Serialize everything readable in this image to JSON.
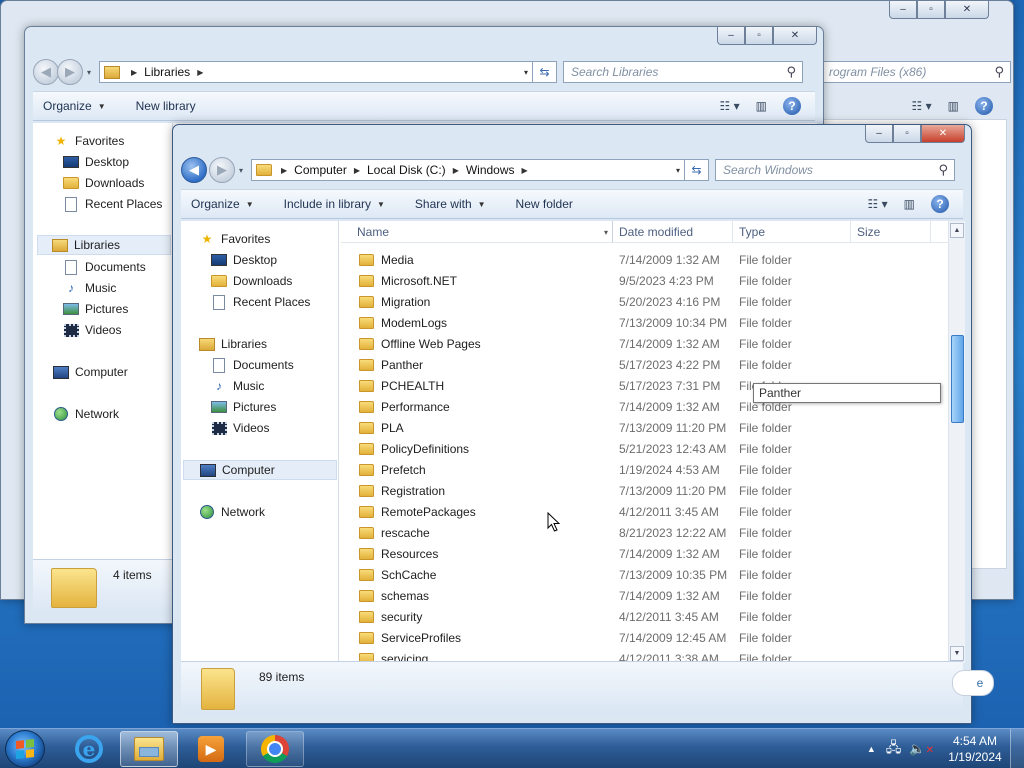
{
  "window_back": {
    "title_buttons": {
      "min": "–",
      "max": "▫",
      "close": "✕"
    },
    "search_placeholder": "rogram Files (x86)"
  },
  "window_mid": {
    "address": [
      "Libraries"
    ],
    "search_placeholder": "Search Libraries",
    "toolbar": {
      "organize": "Organize",
      "new_library": "New library"
    },
    "nav": {
      "favorites": "Favorites",
      "desktop": "Desktop",
      "downloads": "Downloads",
      "recent": "Recent Places",
      "libraries": "Libraries",
      "documents": "Documents",
      "music": "Music",
      "pictures": "Pictures",
      "videos": "Videos",
      "computer": "Computer",
      "network": "Network"
    },
    "status": "4 items"
  },
  "window_front": {
    "address": [
      "Computer",
      "Local Disk (C:)",
      "Windows"
    ],
    "search_placeholder": "Search Windows",
    "toolbar": {
      "organize": "Organize",
      "include": "Include in library",
      "share": "Share with",
      "new_folder": "New folder"
    },
    "nav": {
      "favorites": "Favorites",
      "desktop": "Desktop",
      "downloads": "Downloads",
      "recent": "Recent Places",
      "libraries": "Libraries",
      "documents": "Documents",
      "music": "Music",
      "pictures": "Pictures",
      "videos": "Videos",
      "computer": "Computer",
      "network": "Network"
    },
    "columns": {
      "name": "Name",
      "date": "Date modified",
      "type": "Type",
      "size": "Size"
    },
    "rows": [
      {
        "name": "Media",
        "date": "7/14/2009 1:32 AM",
        "type": "File folder"
      },
      {
        "name": "Microsoft.NET",
        "date": "9/5/2023 4:23 PM",
        "type": "File folder"
      },
      {
        "name": "Migration",
        "date": "5/20/2023 4:16 PM",
        "type": "File folder"
      },
      {
        "name": "ModemLogs",
        "date": "7/13/2009 10:34 PM",
        "type": "File folder"
      },
      {
        "name": "Offline Web Pages",
        "date": "7/14/2009 1:32 AM",
        "type": "File folder"
      },
      {
        "name": "Panther",
        "date": "5/17/2023 4:22 PM",
        "type": "File folder"
      },
      {
        "name": "PCHEALTH",
        "date": "5/17/2023 7:31 PM",
        "type": "File folder"
      },
      {
        "name": "Performance",
        "date": "7/14/2009 1:32 AM",
        "type": "File folder"
      },
      {
        "name": "PLA",
        "date": "7/13/2009 11:20 PM",
        "type": "File folder"
      },
      {
        "name": "PolicyDefinitions",
        "date": "5/21/2023 12:43 AM",
        "type": "File folder"
      },
      {
        "name": "Prefetch",
        "date": "1/19/2024 4:53 AM",
        "type": "File folder"
      },
      {
        "name": "Registration",
        "date": "7/13/2009 11:20 PM",
        "type": "File folder"
      },
      {
        "name": "RemotePackages",
        "date": "4/12/2011 3:45 AM",
        "type": "File folder"
      },
      {
        "name": "rescache",
        "date": "8/21/2023 12:22 AM",
        "type": "File folder"
      },
      {
        "name": "Resources",
        "date": "7/14/2009 1:32 AM",
        "type": "File folder"
      },
      {
        "name": "SchCache",
        "date": "7/13/2009 10:35 PM",
        "type": "File folder"
      },
      {
        "name": "schemas",
        "date": "7/14/2009 1:32 AM",
        "type": "File folder"
      },
      {
        "name": "security",
        "date": "4/12/2011 3:45 AM",
        "type": "File folder"
      },
      {
        "name": "ServiceProfiles",
        "date": "7/14/2009 12:45 AM",
        "type": "File folder"
      },
      {
        "name": "servicing",
        "date": "4/12/2011 3:38 AM",
        "type": "File folder"
      }
    ],
    "tooltip": "Panther",
    "status": "89 items"
  },
  "taskbar": {
    "time": "4:54 AM",
    "date": "1/19/2024",
    "tray_arrow": "▲"
  },
  "behind_partial_label": "e"
}
